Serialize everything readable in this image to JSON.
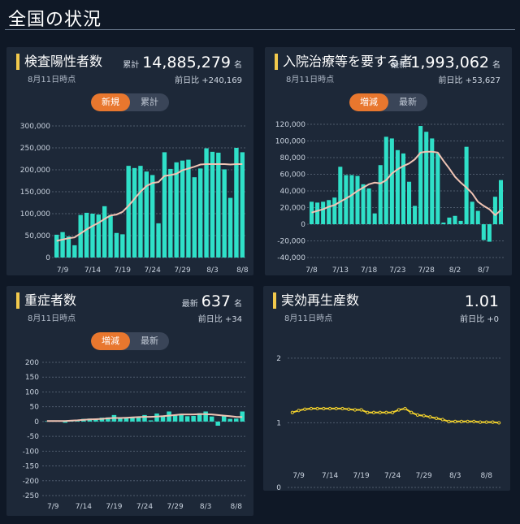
{
  "page": {
    "title": "全国の状況"
  },
  "panels": {
    "positive": {
      "title": "検査陽性者数",
      "date": "8月11日時点",
      "stat_label": "累計",
      "stat_value": "14,885,279",
      "stat_unit": "名",
      "diff": "前日比 +240,169",
      "toggle": [
        "新規",
        "累計"
      ],
      "active": 0
    },
    "hospital": {
      "title": "入院治療等を要する者",
      "date": "8月11日時点",
      "stat_label": "最新",
      "stat_value": "1,993,062",
      "stat_unit": "名",
      "diff": "前日比 +53,627",
      "toggle": [
        "増減",
        "最新"
      ],
      "active": 0
    },
    "severe": {
      "title": "重症者数",
      "date": "8月11日時点",
      "stat_label": "最新",
      "stat_value": "637",
      "stat_unit": "名",
      "diff": "前日比 +34",
      "toggle": [
        "増減",
        "最新"
      ],
      "active": 0
    },
    "rt": {
      "title": "実効再生産数",
      "date": "8月11日時点",
      "stat_value": "1.01",
      "diff": "前日比 +0"
    }
  },
  "colors": {
    "bar": "#2fe0c8",
    "line": "#f0c4b4",
    "rt_line": "#f2d12c",
    "grid": "#4e5b6d",
    "accent": "#e8772e"
  },
  "chart_data": [
    {
      "type": "bar",
      "ylim": [
        0,
        300000
      ],
      "yticks": [
        "300,000",
        "250,000",
        "200,000",
        "150,000",
        "100,000",
        "50,000",
        "0"
      ],
      "xticks": [
        {
          "i": 1,
          "label": "7/9"
        },
        {
          "i": 6,
          "label": "7/14"
        },
        {
          "i": 11,
          "label": "7/19"
        },
        {
          "i": 16,
          "label": "7/24"
        },
        {
          "i": 21,
          "label": "7/29"
        },
        {
          "i": 26,
          "label": "8/3"
        },
        {
          "i": 31,
          "label": "8/8"
        }
      ],
      "values": [
        52000,
        58000,
        48000,
        28000,
        97000,
        102000,
        100000,
        98000,
        117000,
        97000,
        56000,
        53000,
        209000,
        204000,
        209000,
        196000,
        188000,
        78000,
        240000,
        202000,
        217000,
        221000,
        223000,
        183000,
        203000,
        249000,
        241000,
        239000,
        201000,
        136000,
        250000,
        240000
      ],
      "ma": [
        38000,
        41000,
        44000,
        46000,
        55000,
        64000,
        72000,
        79000,
        88000,
        96000,
        98000,
        104000,
        118000,
        134000,
        150000,
        163000,
        170000,
        172000,
        186000,
        188000,
        191000,
        199000,
        203000,
        207000,
        212000,
        213000,
        213000,
        213000,
        213000,
        212000,
        213000,
        213000
      ]
    },
    {
      "type": "bar",
      "ylim": [
        -40000,
        120000
      ],
      "yticks": [
        "120,000",
        "100,000",
        "80,000",
        "60,000",
        "40,000",
        "20,000",
        "0",
        "-20,000",
        "-40,000"
      ],
      "xticks": [
        {
          "i": 0,
          "label": "7/8"
        },
        {
          "i": 5,
          "label": "7/13"
        },
        {
          "i": 10,
          "label": "7/18"
        },
        {
          "i": 15,
          "label": "7/23"
        },
        {
          "i": 20,
          "label": "7/28"
        },
        {
          "i": 25,
          "label": "8/2"
        },
        {
          "i": 30,
          "label": "8/7"
        }
      ],
      "values": [
        27000,
        26000,
        27000,
        29000,
        32000,
        69000,
        59000,
        59000,
        58000,
        48000,
        43000,
        13000,
        71000,
        105000,
        103000,
        89000,
        85000,
        51000,
        22000,
        118000,
        111000,
        103000,
        85000,
        2000,
        8000,
        10000,
        4000,
        93000,
        27000,
        16000,
        -19000,
        -21000,
        33000,
        53000
      ],
      "ma": [
        14000,
        16000,
        18000,
        21000,
        23000,
        27000,
        31000,
        35000,
        40000,
        44000,
        48000,
        50000,
        49000,
        53000,
        61000,
        66000,
        70000,
        73000,
        78000,
        86000,
        87000,
        87000,
        86000,
        76000,
        67000,
        57000,
        50000,
        44000,
        37000,
        27000,
        22000,
        18000,
        11000,
        17000
      ]
    },
    {
      "type": "bar",
      "ylim": [
        -250,
        200
      ],
      "yticks": [
        "200",
        "150",
        "100",
        "50",
        "0",
        "-50",
        "-100",
        "-150",
        "-200",
        "-250"
      ],
      "xticks": [
        {
          "i": 1,
          "label": "7/9"
        },
        {
          "i": 6,
          "label": "7/14"
        },
        {
          "i": 11,
          "label": "7/19"
        },
        {
          "i": 16,
          "label": "7/24"
        },
        {
          "i": 21,
          "label": "7/29"
        },
        {
          "i": 26,
          "label": "8/3"
        },
        {
          "i": 31,
          "label": "8/8"
        }
      ],
      "values": [
        1,
        1,
        2,
        -4,
        3,
        6,
        9,
        10,
        7,
        13,
        14,
        22,
        11,
        13,
        14,
        14,
        22,
        4,
        27,
        19,
        34,
        23,
        26,
        18,
        19,
        28,
        34,
        17,
        -14,
        19,
        9,
        10,
        34
      ],
      "ma": [
        2,
        2,
        2,
        2,
        3,
        4,
        6,
        7,
        8,
        9,
        11,
        12,
        12,
        13,
        14,
        15,
        16,
        16,
        17,
        18,
        20,
        22,
        24,
        24,
        24,
        25,
        25,
        24,
        22,
        20,
        18,
        16,
        15
      ]
    },
    {
      "type": "line",
      "ylim": [
        0,
        2.3
      ],
      "yticks": [
        "2",
        "1",
        "0"
      ],
      "xticks": [
        {
          "i": 1,
          "label": "7/9"
        },
        {
          "i": 6,
          "label": "7/14"
        },
        {
          "i": 11,
          "label": "7/19"
        },
        {
          "i": 16,
          "label": "7/24"
        },
        {
          "i": 21,
          "label": "7/29"
        },
        {
          "i": 26,
          "label": "8/3"
        },
        {
          "i": 31,
          "label": "8/8"
        }
      ],
      "values": [
        1.16,
        1.19,
        1.21,
        1.22,
        1.22,
        1.22,
        1.22,
        1.22,
        1.22,
        1.21,
        1.2,
        1.2,
        1.16,
        1.16,
        1.16,
        1.16,
        1.16,
        1.2,
        1.22,
        1.16,
        1.12,
        1.11,
        1.09,
        1.07,
        1.05,
        1.02,
        1.02,
        1.02,
        1.02,
        1.02,
        1.01,
        1.01,
        1.01,
        1.0
      ]
    }
  ]
}
